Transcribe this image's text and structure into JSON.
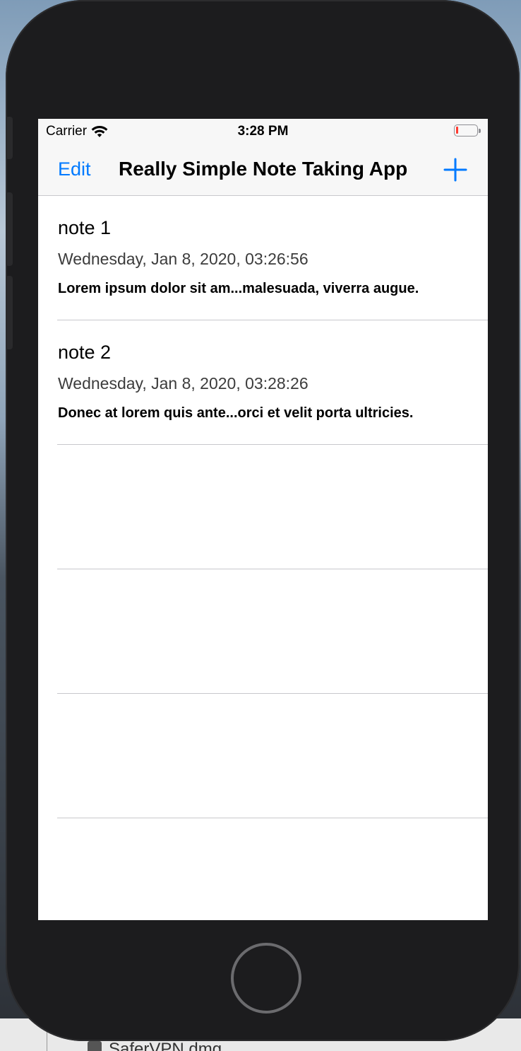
{
  "desktop": {
    "file_label": "SaferVPN.dmg"
  },
  "status_bar": {
    "carrier": "Carrier",
    "time": "3:28 PM",
    "battery_color": "#ff3b30"
  },
  "nav": {
    "edit_label": "Edit",
    "title": "Really Simple Note Taking App",
    "add_icon": "plus-icon",
    "accent_color": "#007aff"
  },
  "notes": [
    {
      "title": "note 1",
      "date": "Wednesday, Jan 8, 2020, 03:26:56",
      "preview": "Lorem ipsum dolor sit am...malesuada, viverra augue."
    },
    {
      "title": "note 2",
      "date": "Wednesday, Jan 8, 2020, 03:28:26",
      "preview": "Donec at lorem quis ante...orci et velit porta ultricies."
    }
  ]
}
